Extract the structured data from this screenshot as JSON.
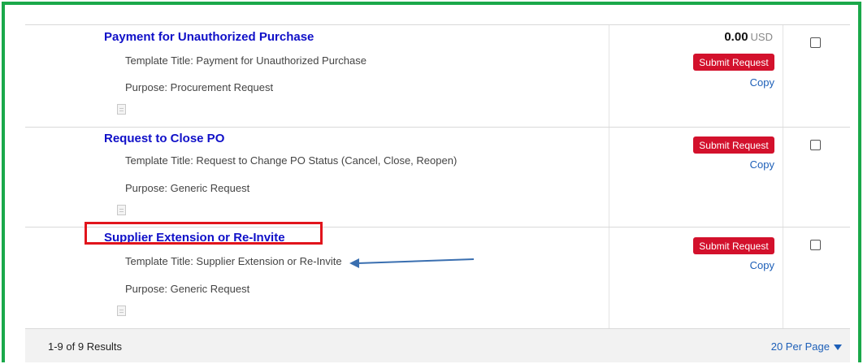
{
  "rows": [
    {
      "title": "Payment for Unauthorized Purchase",
      "template_title": "Template Title: Payment for Unauthorized Purchase",
      "purpose": "Purpose: Procurement Request",
      "amount": "0.00",
      "currency": "USD",
      "submit_label": "Submit Request",
      "copy_label": "Copy"
    },
    {
      "title": "Request to Close PO",
      "template_title": "Template Title: Request to Change PO Status (Cancel, Close, Reopen)",
      "purpose": "Purpose: Generic Request",
      "submit_label": "Submit Request",
      "copy_label": "Copy"
    },
    {
      "title": "Supplier Extension or Re-Invite",
      "template_title": "Template Title: Supplier Extension or Re-Invite",
      "purpose": "Purpose: Generic Request",
      "submit_label": "Submit Request",
      "copy_label": "Copy"
    }
  ],
  "footer": {
    "results": "1-9 of 9 Results",
    "per_page": "20 Per Page"
  },
  "annotations": {
    "highlight_color": "#e1141c",
    "arrow_color": "#3a6fb0"
  },
  "colors": {
    "frame": "#1aa84a",
    "link": "#1010c8",
    "button": "#d3112c"
  }
}
